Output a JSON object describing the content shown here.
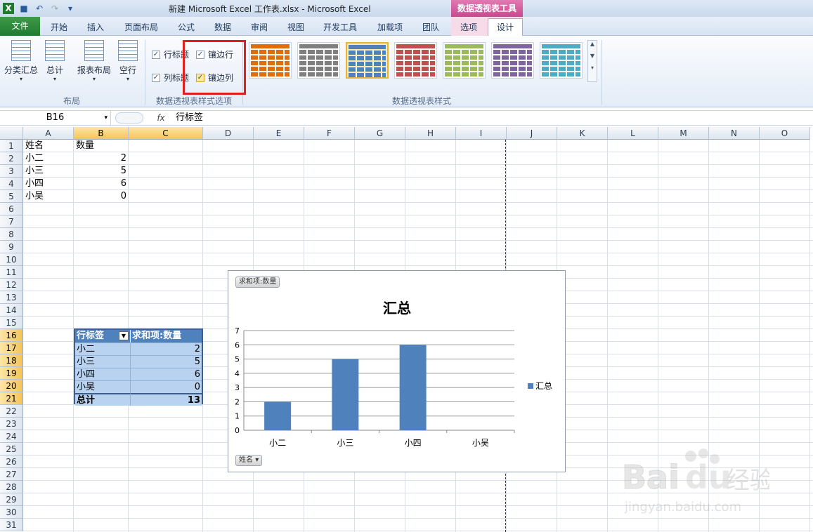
{
  "window": {
    "title": "新建 Microsoft Excel 工作表.xlsx  -  Microsoft Excel",
    "context_tool": "数据透视表工具"
  },
  "tabs": [
    "文件",
    "开始",
    "插入",
    "页面布局",
    "公式",
    "数据",
    "审阅",
    "视图",
    "开发工具",
    "加载项",
    "团队",
    "选项",
    "设计"
  ],
  "ribbon": {
    "layout_buttons": [
      "分类汇总",
      "总计",
      "报表布局",
      "空行"
    ],
    "layout_group": "布局",
    "style_options": [
      {
        "label": "行标题",
        "checked": true
      },
      {
        "label": "列标题",
        "checked": true
      },
      {
        "label": "镶边行",
        "checked": true
      },
      {
        "label": "镶边列",
        "checked": true
      }
    ],
    "style_options_group": "数据透视表样式选项",
    "styles_group": "数据透视表样式",
    "style_colors": [
      "#e26b0a",
      "#7f7f7f",
      "#4f81bd",
      "#c0504d",
      "#9bbb59",
      "#8064a2",
      "#4bacc6"
    ]
  },
  "formula_bar": {
    "name_box": "B16",
    "fx": "fx",
    "formula": "行标签"
  },
  "columns": [
    "A",
    "B",
    "C",
    "D",
    "E",
    "F",
    "G",
    "H",
    "I",
    "J",
    "K",
    "L",
    "M",
    "N",
    "O"
  ],
  "rows": [
    "1",
    "2",
    "3",
    "4",
    "5",
    "6",
    "7",
    "8",
    "9",
    "10",
    "11",
    "12",
    "13",
    "14",
    "15",
    "16",
    "17",
    "18",
    "19",
    "20",
    "21",
    "22",
    "23",
    "24",
    "25",
    "26",
    "27",
    "28",
    "29",
    "30",
    "31"
  ],
  "cells": {
    "A1": "姓名",
    "B1": "数量",
    "A2": "小二",
    "B2": "2",
    "A3": "小三",
    "B3": "5",
    "A4": "小四",
    "B4": "6",
    "A5": "小吴",
    "B5": "0"
  },
  "pivot": {
    "header_label": "行标签",
    "header_value": "求和项:数量",
    "rows": [
      {
        "label": "小二",
        "value": "2"
      },
      {
        "label": "小三",
        "value": "5"
      },
      {
        "label": "小四",
        "value": "6"
      },
      {
        "label": "小吴",
        "value": "0"
      }
    ],
    "total_label": "总计",
    "total_value": "13"
  },
  "chart_data": {
    "type": "bar",
    "title": "汇总",
    "categories": [
      "小二",
      "小三",
      "小四",
      "小吴"
    ],
    "series": [
      {
        "name": "汇总",
        "values": [
          2,
          5,
          6,
          0
        ],
        "color": "#4f81bd"
      }
    ],
    "ylim": [
      0,
      7
    ],
    "yticks": [
      "0",
      "1",
      "2",
      "3",
      "4",
      "5",
      "6",
      "7"
    ],
    "grid": true,
    "legend": "right",
    "value_field_button": "求和项:数量",
    "axis_field_button": "姓名"
  },
  "watermark": {
    "text1": "Baidu",
    "text2": "经验",
    "url": "jingyan.baidu.com"
  }
}
